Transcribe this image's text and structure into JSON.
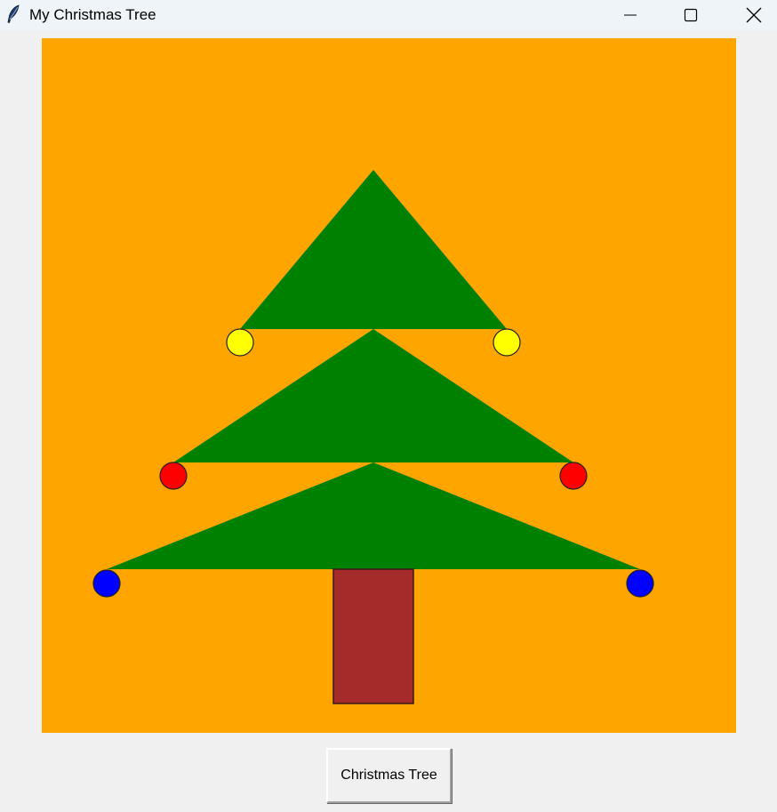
{
  "window": {
    "title": "My Christmas Tree",
    "app_icon": "feather-icon",
    "controls": {
      "minimize_icon": "minimize-icon",
      "maximize_icon": "maximize-icon",
      "close_icon": "close-icon"
    }
  },
  "canvas": {
    "background_color": "#ffa500",
    "tree": {
      "foliage_color": "#008000",
      "trunk_color": "#a52a2a",
      "trunk_outline_color": "#3a1a1a"
    },
    "ornaments": [
      {
        "name": "ornament-top-left",
        "color": "#ffff00"
      },
      {
        "name": "ornament-top-right",
        "color": "#ffff00"
      },
      {
        "name": "ornament-middle-left",
        "color": "#ff0000"
      },
      {
        "name": "ornament-middle-right",
        "color": "#ff0000"
      },
      {
        "name": "ornament-bottom-left",
        "color": "#0000ff"
      },
      {
        "name": "ornament-bottom-right",
        "color": "#0000ff"
      }
    ]
  },
  "button": {
    "label": "Christmas Tree"
  }
}
